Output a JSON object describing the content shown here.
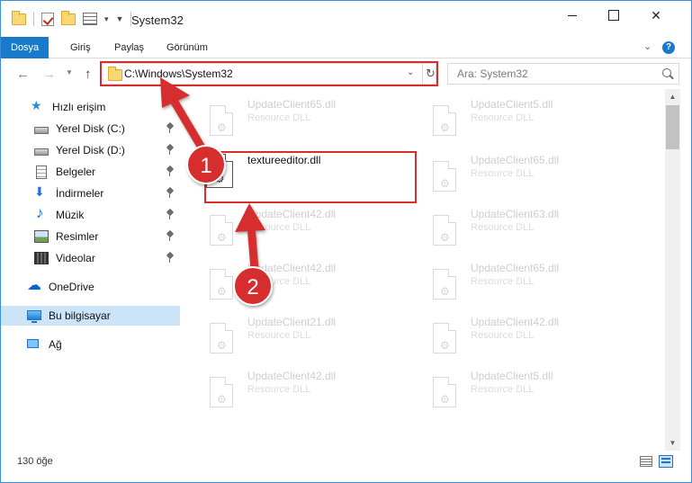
{
  "window": {
    "title": "System32"
  },
  "ribbon": {
    "tabs": [
      "Dosya",
      "Giriş",
      "Paylaş",
      "Görünüm"
    ]
  },
  "address": {
    "path": "C:\\Windows\\System32"
  },
  "search": {
    "placeholder": "Ara: System32"
  },
  "sidebar": {
    "items": [
      {
        "label": "Hızlı erişim",
        "icon": "star-icon"
      },
      {
        "label": "Yerel Disk (C:)",
        "icon": "disk-icon",
        "pinned": true
      },
      {
        "label": "Yerel Disk (D:)",
        "icon": "disk-icon",
        "pinned": true
      },
      {
        "label": "Belgeler",
        "icon": "document-icon",
        "pinned": true
      },
      {
        "label": "İndirmeler",
        "icon": "download-icon",
        "pinned": true
      },
      {
        "label": "Müzik",
        "icon": "music-icon",
        "pinned": true
      },
      {
        "label": "Resimler",
        "icon": "pictures-icon",
        "pinned": true
      },
      {
        "label": "Videolar",
        "icon": "videos-icon",
        "pinned": true
      },
      {
        "label": "OneDrive",
        "icon": "cloud-icon"
      },
      {
        "label": "Bu bilgisayar",
        "icon": "computer-icon",
        "selected": true
      },
      {
        "label": "Ağ",
        "icon": "network-icon"
      }
    ]
  },
  "files": {
    "focused": {
      "name": "textureeditor.dll",
      "type": ""
    },
    "column_left": [
      {
        "name": "UpdateClient65.dll",
        "type": "Resource DLL"
      },
      {
        "name": "UpdateClient42.dll",
        "type": "Resource DLL"
      },
      {
        "name": "UpdateClient42.dll",
        "type": "Resource DLL"
      },
      {
        "name": "UpdateClient21.dll",
        "type": "Resource DLL"
      },
      {
        "name": "UpdateClient42.dll",
        "type": "Resource DLL"
      }
    ],
    "column_right": [
      {
        "name": "UpdateClient5.dll",
        "type": "Resource DLL"
      },
      {
        "name": "UpdateClient65.dll",
        "type": "Resource DLL"
      },
      {
        "name": "UpdateClient63.dll",
        "type": "Resource DLL"
      },
      {
        "name": "UpdateClient65.dll",
        "type": "Resource DLL"
      },
      {
        "name": "UpdateClient42.dll",
        "type": "Resource DLL"
      },
      {
        "name": "UpdateClient5.dll",
        "type": "Resource DLL"
      }
    ]
  },
  "status": {
    "count": "130 öğe"
  },
  "annotations": {
    "step1": "1",
    "step2": "2",
    "color": "#d62d2d"
  }
}
